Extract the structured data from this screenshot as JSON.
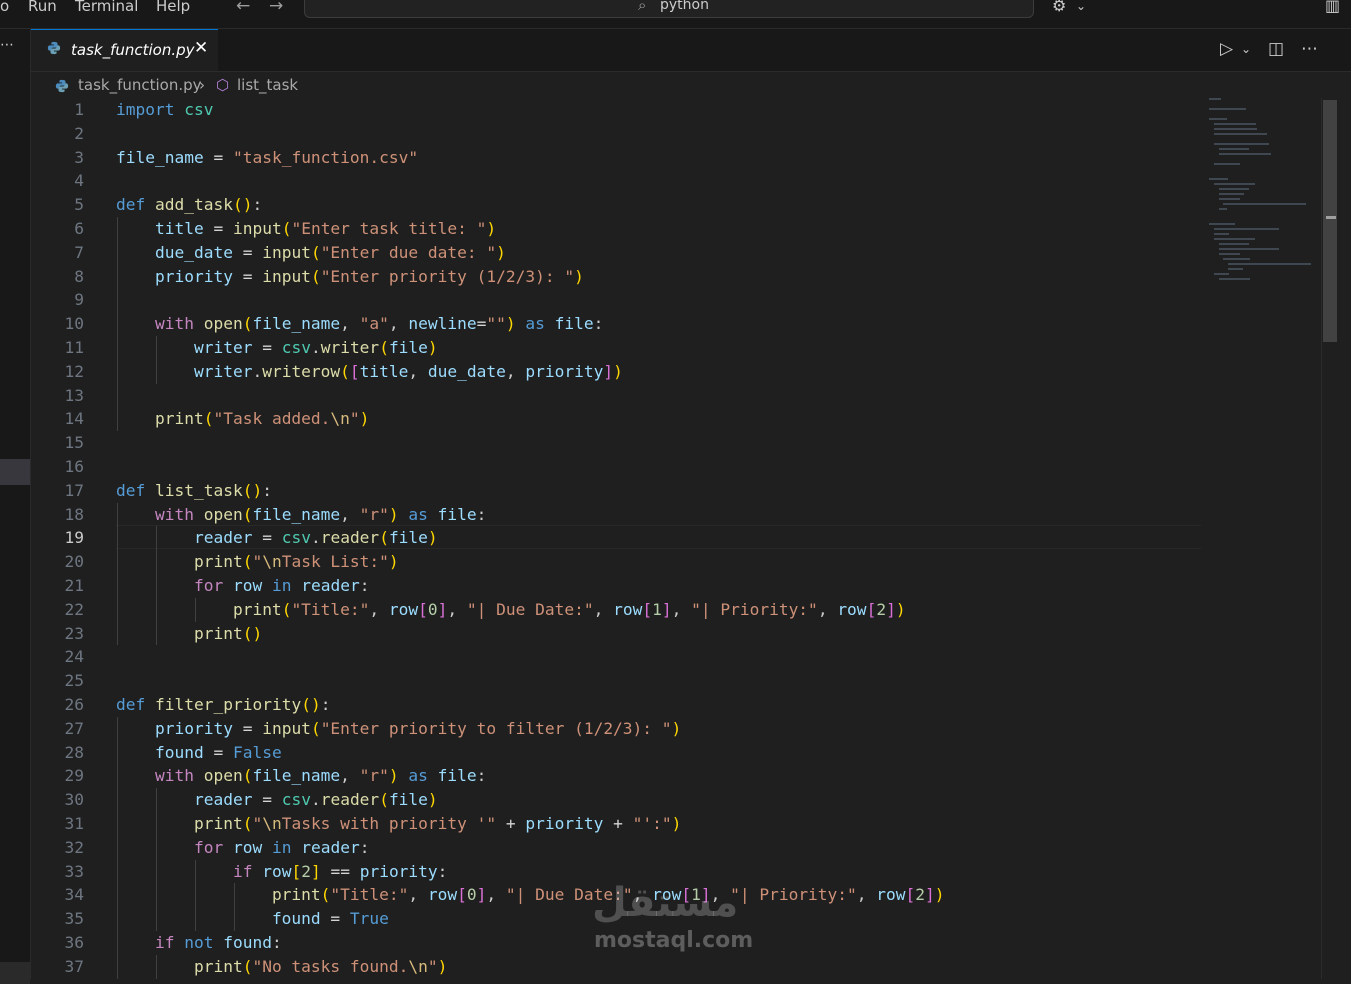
{
  "menu": {
    "partial": "o",
    "run": "Run",
    "terminal": "Terminal",
    "help": "Help"
  },
  "command_center": {
    "label": "python",
    "icon": "search-icon"
  },
  "tab": {
    "filename": "task_function.py",
    "close_glyph": "✕",
    "icon": "python-icon"
  },
  "breadcrumb": {
    "file": "task_function.py",
    "separator": "›",
    "symbol": "list_task",
    "symbol_icon": "cube-icon"
  },
  "editor": {
    "current_line": 19,
    "lines": [
      {
        "n": "1",
        "t": "import csv"
      },
      {
        "n": "2",
        "t": ""
      },
      {
        "n": "3",
        "t": "file_name = \"task_function.csv\""
      },
      {
        "n": "4",
        "t": ""
      },
      {
        "n": "5",
        "t": "def add_task():"
      },
      {
        "n": "6",
        "t": "    title = input(\"Enter task title: \")"
      },
      {
        "n": "7",
        "t": "    due_date = input(\"Enter due date: \")"
      },
      {
        "n": "8",
        "t": "    priority = input(\"Enter priority (1/2/3): \")"
      },
      {
        "n": "9",
        "t": ""
      },
      {
        "n": "10",
        "t": "    with open(file_name, \"a\", newline=\"\") as file:"
      },
      {
        "n": "11",
        "t": "        writer = csv.writer(file)"
      },
      {
        "n": "12",
        "t": "        writer.writerow([title, due_date, priority])"
      },
      {
        "n": "13",
        "t": ""
      },
      {
        "n": "14",
        "t": "    print(\"Task added.\\n\")"
      },
      {
        "n": "15",
        "t": ""
      },
      {
        "n": "16",
        "t": ""
      },
      {
        "n": "17",
        "t": "def list_task():"
      },
      {
        "n": "18",
        "t": "    with open(file_name, \"r\") as file:"
      },
      {
        "n": "19",
        "t": "        reader = csv.reader(file)"
      },
      {
        "n": "20",
        "t": "        print(\"\\nTask List:\")"
      },
      {
        "n": "21",
        "t": "        for row in reader:"
      },
      {
        "n": "22",
        "t": "            print(\"Title:\", row[0], \"| Due Date:\", row[1], \"| Priority:\", row[2])"
      },
      {
        "n": "23",
        "t": "        print()"
      },
      {
        "n": "24",
        "t": ""
      },
      {
        "n": "25",
        "t": ""
      },
      {
        "n": "26",
        "t": "def filter_priority():"
      },
      {
        "n": "27",
        "t": "    priority = input(\"Enter priority to filter (1/2/3): \")"
      },
      {
        "n": "28",
        "t": "    found = False"
      },
      {
        "n": "29",
        "t": "    with open(file_name, \"r\") as file:"
      },
      {
        "n": "30",
        "t": "        reader = csv.reader(file)"
      },
      {
        "n": "31",
        "t": "        print(\"\\nTasks with priority '\" + priority + \"':\")"
      },
      {
        "n": "32",
        "t": "        for row in reader:"
      },
      {
        "n": "33",
        "t": "            if row[2] == priority:"
      },
      {
        "n": "34",
        "t": "                print(\"Title:\", row[0], \"| Due Date:\", row[1], \"| Priority:\", row[2])"
      },
      {
        "n": "35",
        "t": "                found = True"
      },
      {
        "n": "36",
        "t": "    if not found:"
      },
      {
        "n": "37",
        "t": "        print(\"No tasks found.\\n\")"
      }
    ]
  },
  "watermark": {
    "arabic": "مستقل",
    "latin": "mostaql.com"
  },
  "colors": {
    "background": "#1f1f1f",
    "accent": "#0078d4",
    "keyword": "#569cd6",
    "string": "#ce9178",
    "function": "#dcdcaa",
    "variable": "#9cdcfe"
  }
}
